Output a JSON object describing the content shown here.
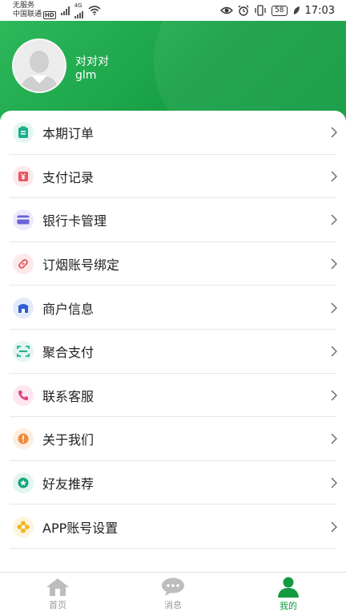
{
  "status_bar": {
    "carrier_line1": "无服务",
    "carrier_line2": "中国联通",
    "hd": "HD",
    "network": "4G",
    "battery": "58",
    "time": "17:03"
  },
  "profile": {
    "name": "对对对",
    "user_id": "glm"
  },
  "menu": [
    {
      "label": "本期订单",
      "icon": "clipboard-icon",
      "bg": "#e4f6f1",
      "fg": "#1dae8a"
    },
    {
      "label": "支付记录",
      "icon": "yuan-receipt-icon",
      "bg": "#fde8ea",
      "fg": "#e8545e"
    },
    {
      "label": "银行卡管理",
      "icon": "bank-card-icon",
      "bg": "#ebe9fb",
      "fg": "#6b63d9"
    },
    {
      "label": "订烟账号绑定",
      "icon": "link-icon",
      "bg": "#fde8ea",
      "fg": "#e8545e"
    },
    {
      "label": "商户信息",
      "icon": "store-icon",
      "bg": "#e3ebfb",
      "fg": "#2e5fd1"
    },
    {
      "label": "聚合支付",
      "icon": "scan-icon",
      "bg": "#e2f5f0",
      "fg": "#1fae8c"
    },
    {
      "label": "联系客服",
      "icon": "phone-icon",
      "bg": "#fde6ef",
      "fg": "#e0437e"
    },
    {
      "label": "关于我们",
      "icon": "info-icon",
      "bg": "#fdeee0",
      "fg": "#f08a3c"
    },
    {
      "label": "好友推荐",
      "icon": "star-badge-icon",
      "bg": "#e2f5ef",
      "fg": "#19a57c"
    },
    {
      "label": "APP账号设置",
      "icon": "flower-settings-icon",
      "bg": "#fdf4dc",
      "fg": "#f2b51e"
    }
  ],
  "bottom_nav": [
    {
      "label": "首页",
      "icon": "home-icon",
      "active": false
    },
    {
      "label": "消息",
      "icon": "message-icon",
      "active": false
    },
    {
      "label": "我的",
      "icon": "user-icon",
      "active": true
    }
  ],
  "colors": {
    "brand_green": "#119a3f",
    "inactive_gray": "#999999"
  }
}
